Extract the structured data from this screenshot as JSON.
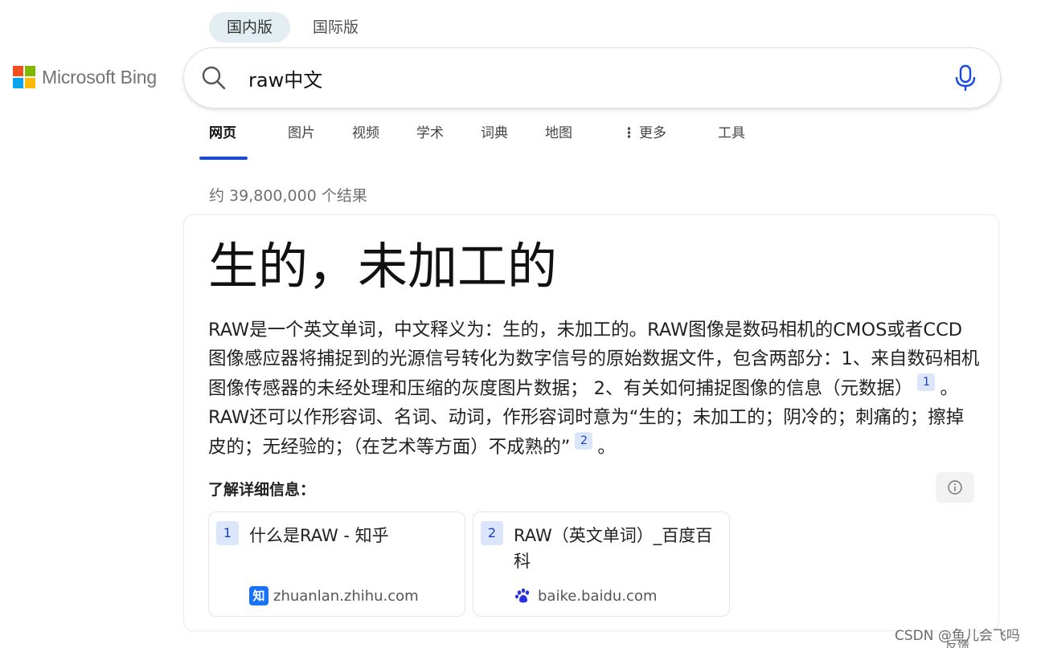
{
  "region_tabs": [
    {
      "label": "国内版",
      "active": true
    },
    {
      "label": "国际版",
      "active": false
    }
  ],
  "logo": {
    "text": "Microsoft Bing",
    "colors": [
      "#f25022",
      "#7fba00",
      "#00a4ef",
      "#ffb900"
    ]
  },
  "search": {
    "value": "raw中文",
    "icon": "search-icon",
    "mic_icon": "microphone-icon",
    "mic_color": "#174ae4"
  },
  "nav": [
    {
      "label": "网页",
      "active": true
    },
    {
      "label": "图片"
    },
    {
      "label": "视频"
    },
    {
      "label": "学术"
    },
    {
      "label": "词典"
    },
    {
      "label": "地图"
    },
    {
      "label": "更多",
      "icon": "more-vertical-icon"
    },
    {
      "label": "工具"
    }
  ],
  "result_count": "约 39,800,000 个结果",
  "answer": {
    "title": "生的，未加工的",
    "body_part1": "RAW是一个英文单词，中文释义为：生的，未加工的。RAW图像是数码相机的CMOS或者CCD图像感应器将捕捉到的光源信号转化为数字信号的原始数据文件，包含两部分：1、来自数码相机图像传感器的未经处理和压缩的灰度图片数据； 2、有关如何捕捉图像的信息（元数据）",
    "cite1": "1",
    "body_part2": "。RAW还可以作形容词、名词、动词，作形容词时意为“生的；未加工的；阴冷的；刺痛的；擦掉皮的；无经验的；（在艺术等方面）不成熟的”",
    "cite2": "2",
    "body_part3": "。",
    "learn_more": "了解详细信息：",
    "info_icon": "info-icon",
    "sources": [
      {
        "num": "1",
        "title": "什么是RAW - 知乎",
        "site": "zhuanlan.zhihu.com",
        "site_icon": "知",
        "site_icon_name": "zhihu-icon"
      },
      {
        "num": "2",
        "title": "RAW（英文单词）_百度百科",
        "site": "baike.baidu.com",
        "site_icon_name": "baidu-paw-icon"
      }
    ]
  },
  "watermark": "CSDN @鱼儿会飞吗",
  "feedback": "反馈",
  "colors": {
    "accent": "#174ae4",
    "cite_bg": "#dbe6fb",
    "region_active_bg": "#e3eef2"
  }
}
